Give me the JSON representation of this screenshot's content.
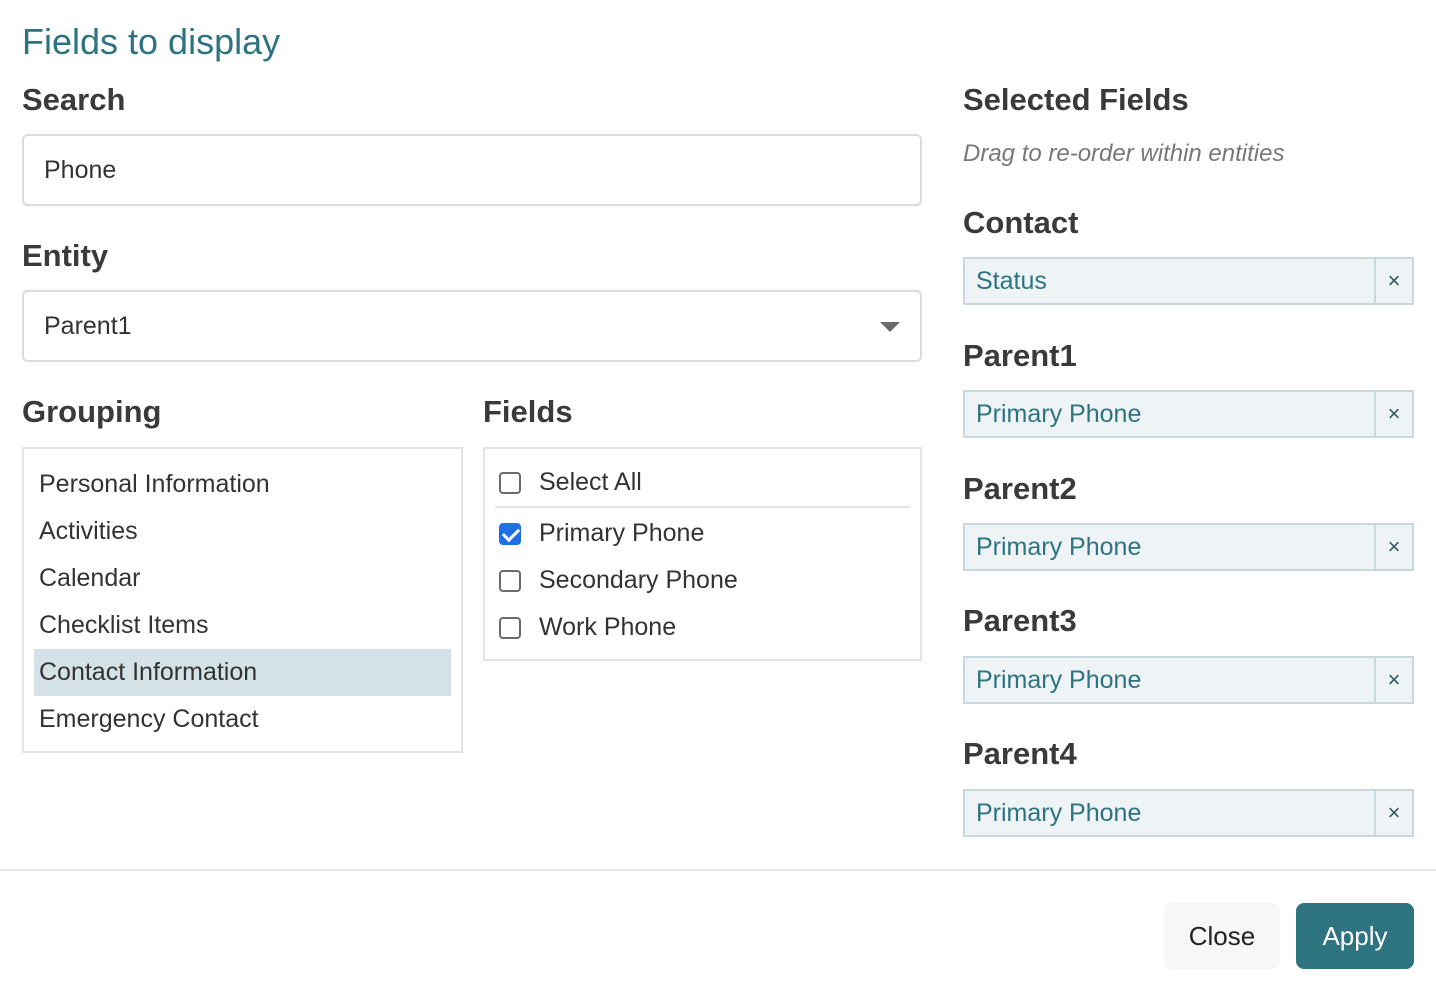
{
  "dialog": {
    "title": "Fields to display"
  },
  "search": {
    "label": "Search",
    "value": "Phone"
  },
  "entity": {
    "label": "Entity",
    "selected": "Parent1"
  },
  "grouping": {
    "label": "Grouping",
    "items": [
      {
        "label": "Personal Information",
        "active": false
      },
      {
        "label": "Activities",
        "active": false
      },
      {
        "label": "Calendar",
        "active": false
      },
      {
        "label": "Checklist Items",
        "active": false
      },
      {
        "label": "Contact Information",
        "active": true
      },
      {
        "label": "Emergency Contact",
        "active": false
      }
    ]
  },
  "fields": {
    "label": "Fields",
    "select_all": {
      "label": "Select All",
      "checked": false
    },
    "items": [
      {
        "label": "Primary Phone",
        "checked": true
      },
      {
        "label": "Secondary Phone",
        "checked": false
      },
      {
        "label": "Work Phone",
        "checked": false
      }
    ]
  },
  "selected": {
    "title": "Selected Fields",
    "subtitle": "Drag to re-order within entities",
    "groups": [
      {
        "entity": "Contact",
        "field": "Status"
      },
      {
        "entity": "Parent1",
        "field": "Primary Phone"
      },
      {
        "entity": "Parent2",
        "field": "Primary Phone"
      },
      {
        "entity": "Parent3",
        "field": "Primary Phone"
      },
      {
        "entity": "Parent4",
        "field": "Primary Phone"
      }
    ],
    "remove_symbol": "×"
  },
  "footer": {
    "close_label": "Close",
    "apply_label": "Apply"
  },
  "colors": {
    "accent": "#2e7380",
    "active_row": "#d4e1e6",
    "chip_bg": "#eef3f5",
    "checkbox": "#1f6fe5"
  }
}
